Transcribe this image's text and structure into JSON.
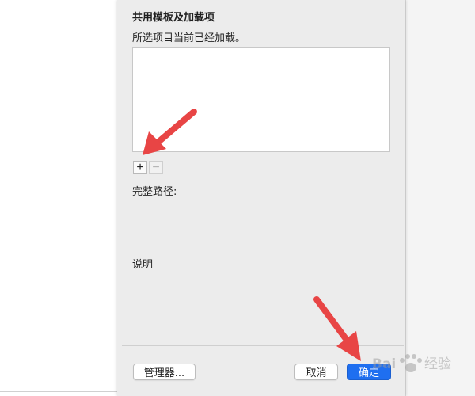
{
  "dialog": {
    "section_title": "共用模板及加载项",
    "status_text": "所选项目当前已经加载。",
    "add_button": "+",
    "remove_button": "−",
    "full_path_label": "完整路径:",
    "description_label": "说明"
  },
  "buttons": {
    "manager": "管理器...",
    "cancel": "取消",
    "ok": "确定"
  },
  "colors": {
    "accent": "#1f6ff0",
    "annotation_arrow": "#e84545"
  },
  "watermark": {
    "brand_text": "Bai",
    "brand_text_suffix": "经验",
    "icon": "paw-icon"
  }
}
